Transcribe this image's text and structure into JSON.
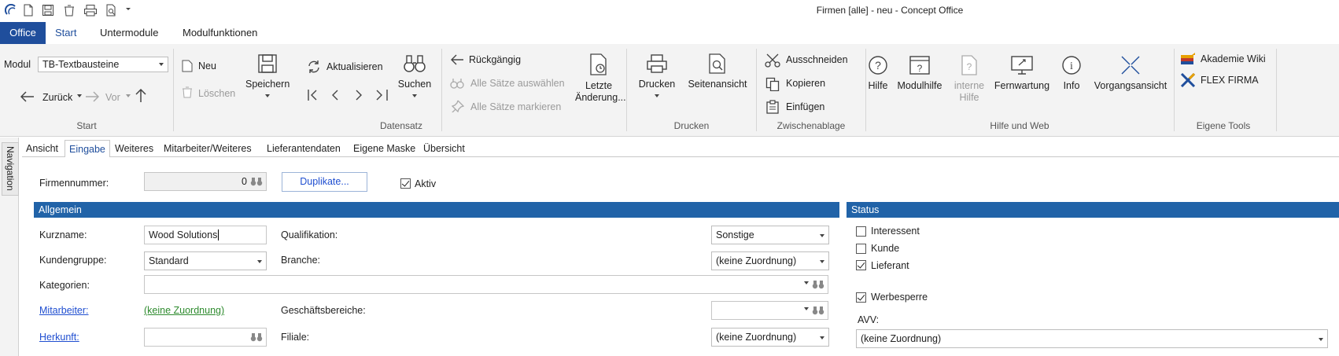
{
  "window": {
    "title": "Firmen [alle] - neu - Concept Office"
  },
  "menu_tabs": [
    "Office",
    "Start",
    "Untermodule",
    "Modulfunktionen"
  ],
  "ribbon": {
    "start": {
      "modul_label": "Modul",
      "modul_value": "TB-Textbausteine",
      "back_label": "Zurück",
      "forward_label": "Vor",
      "group_label": "Start"
    },
    "datensatz": {
      "neu": "Neu",
      "loeschen": "Löschen",
      "speichern": "Speichern",
      "aktualisieren": "Aktualisieren",
      "suchen": "Suchen",
      "rueckgaengig": "Rückgängig",
      "alle_auswaehlen": "Alle Sätze auswählen",
      "alle_markieren": "Alle Sätze markieren",
      "letzte_1": "Letzte",
      "letzte_2": "Änderung...",
      "group_label": "Datensatz"
    },
    "drucken": {
      "drucken": "Drucken",
      "seitenansicht": "Seitenansicht",
      "group_label": "Drucken"
    },
    "zwischenablage": {
      "ausschneiden": "Ausschneiden",
      "kopieren": "Kopieren",
      "einfuegen": "Einfügen",
      "group_label": "Zwischenablage"
    },
    "hilfe": {
      "hilfe": "Hilfe",
      "modulhilfe": "Modulhilfe",
      "interne_1": "interne",
      "interne_2": "Hilfe",
      "fernwartung": "Fernwartung",
      "info": "Info",
      "vorgangsansicht": "Vorgangsansicht",
      "group_label": "Hilfe und Web"
    },
    "eigene_tools": {
      "akademie": "Akademie Wiki",
      "flex": "FLEX FIRMA",
      "group_label": "Eigene Tools"
    }
  },
  "nav_tab": "Navigation",
  "content_tabs": [
    "Ansicht",
    "Eingabe",
    "Weiteres",
    "Mitarbeiter/Weiteres",
    "Lieferantendaten",
    "Eigene Maske",
    "Übersicht"
  ],
  "form": {
    "firmennummer_label": "Firmennummer:",
    "firmennummer_value": "0",
    "duplikate_button": "Duplikate...",
    "aktiv_label": "Aktiv",
    "aktiv_checked": true,
    "allgemein_header": "Allgemein",
    "kurzname_label": "Kurzname:",
    "kurzname_value": "Wood Solutions",
    "kundengruppe_label": "Kundengruppe:",
    "kundengruppe_value": "Standard",
    "kategorien_label": "Kategorien:",
    "mitarbeiter_label": "Mitarbeiter:",
    "mitarbeiter_value": "(keine Zuordnung)",
    "herkunft_label": "Herkunft:",
    "qualifikation_label": "Qualifikation:",
    "qualifikation_value": "Sonstige",
    "branche_label": "Branche:",
    "branche_value": "(keine Zuordnung)",
    "geschaeftsbereiche_label": "Geschäftsbereiche:",
    "filiale_label": "Filiale:",
    "filiale_value": "(keine Zuordnung)"
  },
  "status": {
    "header": "Status",
    "interessent": "Interessent",
    "kunde": "Kunde",
    "lieferant": "Lieferant",
    "werbesperre": "Werbesperre",
    "avv_label": "AVV:",
    "avv_value": "(keine Zuordnung)",
    "checked": {
      "interessent": false,
      "kunde": false,
      "lieferant": true,
      "werbesperre": true
    }
  },
  "colors": {
    "accent": "#1f4e9c",
    "section_header": "#2163a8",
    "link": "#1f4ed0",
    "green_link": "#2e8b2e"
  }
}
